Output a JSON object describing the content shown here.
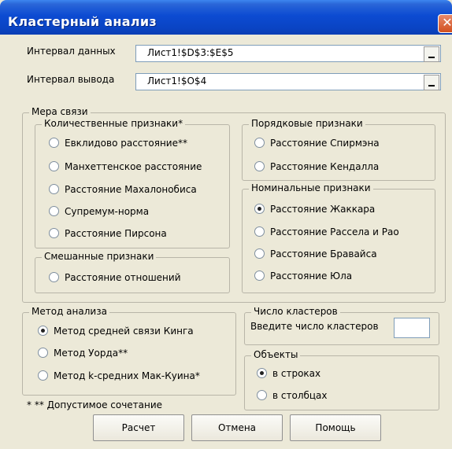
{
  "window": {
    "title": "Кластерный анализ",
    "close_symbol": "✕"
  },
  "inputs": {
    "data_range": {
      "label": "Интервал данных",
      "value": "Лист1!$D$3:$E$5"
    },
    "output_range": {
      "label": "Интервал вывода",
      "value": "Лист1!$O$4"
    }
  },
  "measure": {
    "title": "Мера связи",
    "quantitative": {
      "title": "Количественные признаки*",
      "options": [
        {
          "label": "Евклидово расстояние**",
          "selected": false
        },
        {
          "label": "Манхеттенское расстояние",
          "selected": false
        },
        {
          "label": "Расстояние Махалонобиса",
          "selected": false
        },
        {
          "label": "Супремум-норма",
          "selected": false
        },
        {
          "label": "Расстояние Пирсона",
          "selected": false
        }
      ]
    },
    "mixed": {
      "title": "Смешанные признаки",
      "options": [
        {
          "label": "Расстояние отношений",
          "selected": false
        }
      ]
    },
    "ordinal": {
      "title": "Порядковые признаки",
      "options": [
        {
          "label": "Расстояние Спирмэна",
          "selected": false
        },
        {
          "label": "Расстояние Кендалла",
          "selected": false
        }
      ]
    },
    "nominal": {
      "title": "Номинальные признаки",
      "options": [
        {
          "label": "Расстояние Жаккара",
          "selected": true
        },
        {
          "label": "Расстояние Рассела и Рао",
          "selected": false
        },
        {
          "label": "Расстояние Бравайса",
          "selected": false
        },
        {
          "label": "Расстояние Юла",
          "selected": false
        }
      ]
    }
  },
  "method": {
    "title": "Метод анализа",
    "options": [
      {
        "label": "Метод средней связи Кинга",
        "selected": true
      },
      {
        "label": "Метод Уорда**",
        "selected": false
      },
      {
        "label": "Метод k-средних Мак-Куина*",
        "selected": false
      }
    ]
  },
  "clusters": {
    "title": "Число кластеров",
    "prompt": "Введите число кластеров",
    "value": ""
  },
  "objects": {
    "title": "Объекты",
    "options": [
      {
        "label": "в строках",
        "selected": true
      },
      {
        "label": "в столбцах",
        "selected": false
      }
    ]
  },
  "footnote": "* ** Допустимое сочетание",
  "buttons": {
    "calculate": "Расчет",
    "cancel": "Отмена",
    "help": "Помощь"
  }
}
